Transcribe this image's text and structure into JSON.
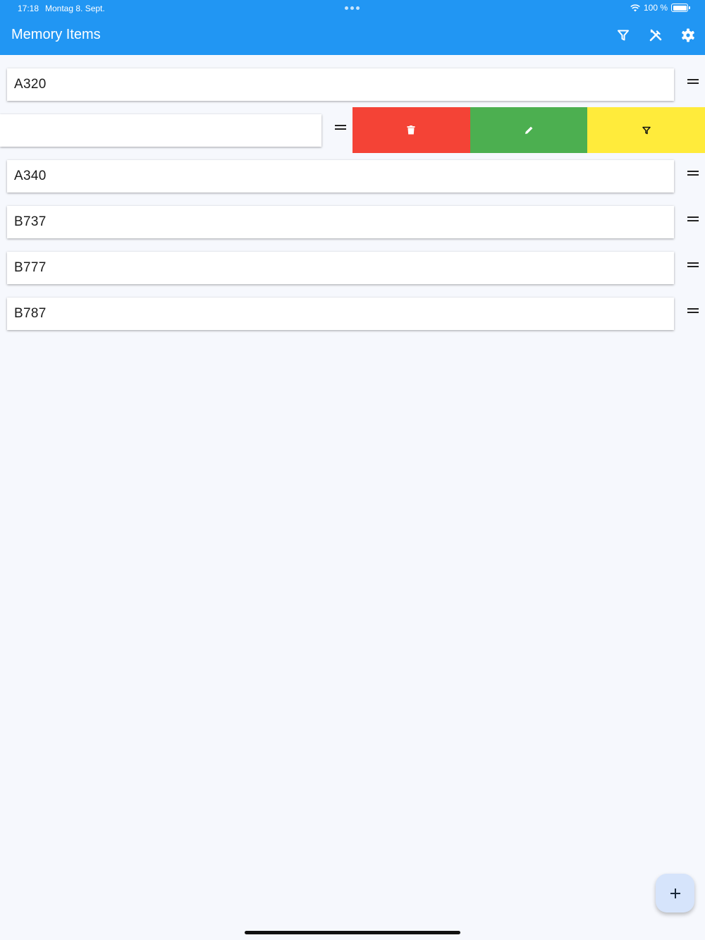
{
  "status_bar": {
    "time": "17:18",
    "date": "Montag 8. Sept.",
    "battery_text": "100 %",
    "icons": [
      "wifi-icon",
      "battery-icon"
    ]
  },
  "app_bar": {
    "title": "Memory Items",
    "background_color": "#2196f3",
    "actions": [
      "filter-icon",
      "tools-icon",
      "gear-icon"
    ]
  },
  "items": [
    {
      "label": "A320"
    },
    {
      "label": "",
      "swiped": true
    },
    {
      "label": "A340"
    },
    {
      "label": "B737"
    },
    {
      "label": "B777"
    },
    {
      "label": "B787"
    }
  ],
  "swipe_actions": [
    {
      "icon": "trash-icon",
      "color": "#f44336"
    },
    {
      "icon": "pencil-icon",
      "color": "#4caf50"
    },
    {
      "icon": "filter-icon",
      "color": "#ffeb3b"
    }
  ],
  "fab": {
    "icon": "plus-icon",
    "color": "#d6e4fb"
  }
}
